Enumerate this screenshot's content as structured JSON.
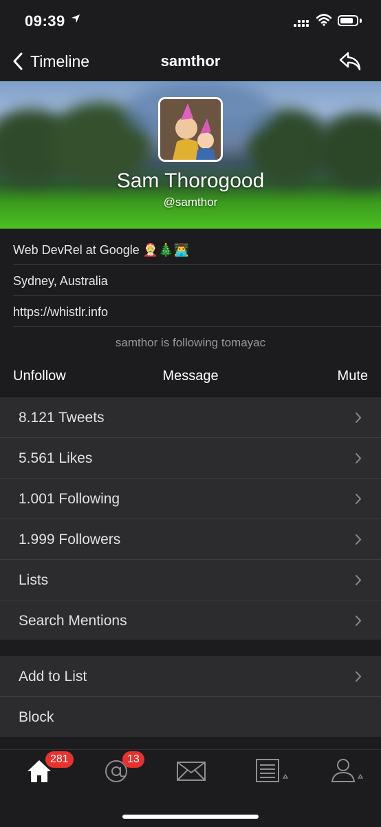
{
  "status_bar": {
    "time": "09:39"
  },
  "nav": {
    "back_label": "Timeline",
    "title": "samthor"
  },
  "profile": {
    "name": "Sam Thorogood",
    "handle": "@samthor",
    "bio": "Web DevRel at Google 🤶🎄👨‍💻",
    "location": "Sydney, Australia",
    "url": "https://whistlr.info",
    "follow_status": "samthor is following tomayac"
  },
  "actions": {
    "unfollow": "Unfollow",
    "message": "Message",
    "mute": "Mute"
  },
  "menu": [
    {
      "label": "8.121 Tweets"
    },
    {
      "label": "5.561 Likes"
    },
    {
      "label": "1.001 Following"
    },
    {
      "label": "1.999 Followers"
    },
    {
      "label": "Lists"
    },
    {
      "label": "Search Mentions"
    }
  ],
  "menu2": [
    {
      "label": "Add to List"
    },
    {
      "label": "Block"
    }
  ],
  "tabbar": {
    "home_badge": "281",
    "mentions_badge": "13",
    "icons": [
      "home-icon",
      "mentions-icon",
      "messages-icon",
      "lists-icon",
      "profile-icon"
    ]
  },
  "colors": {
    "background": "#1c1c1e",
    "list_bg": "#2c2c2e",
    "badge": "#e8322e"
  }
}
